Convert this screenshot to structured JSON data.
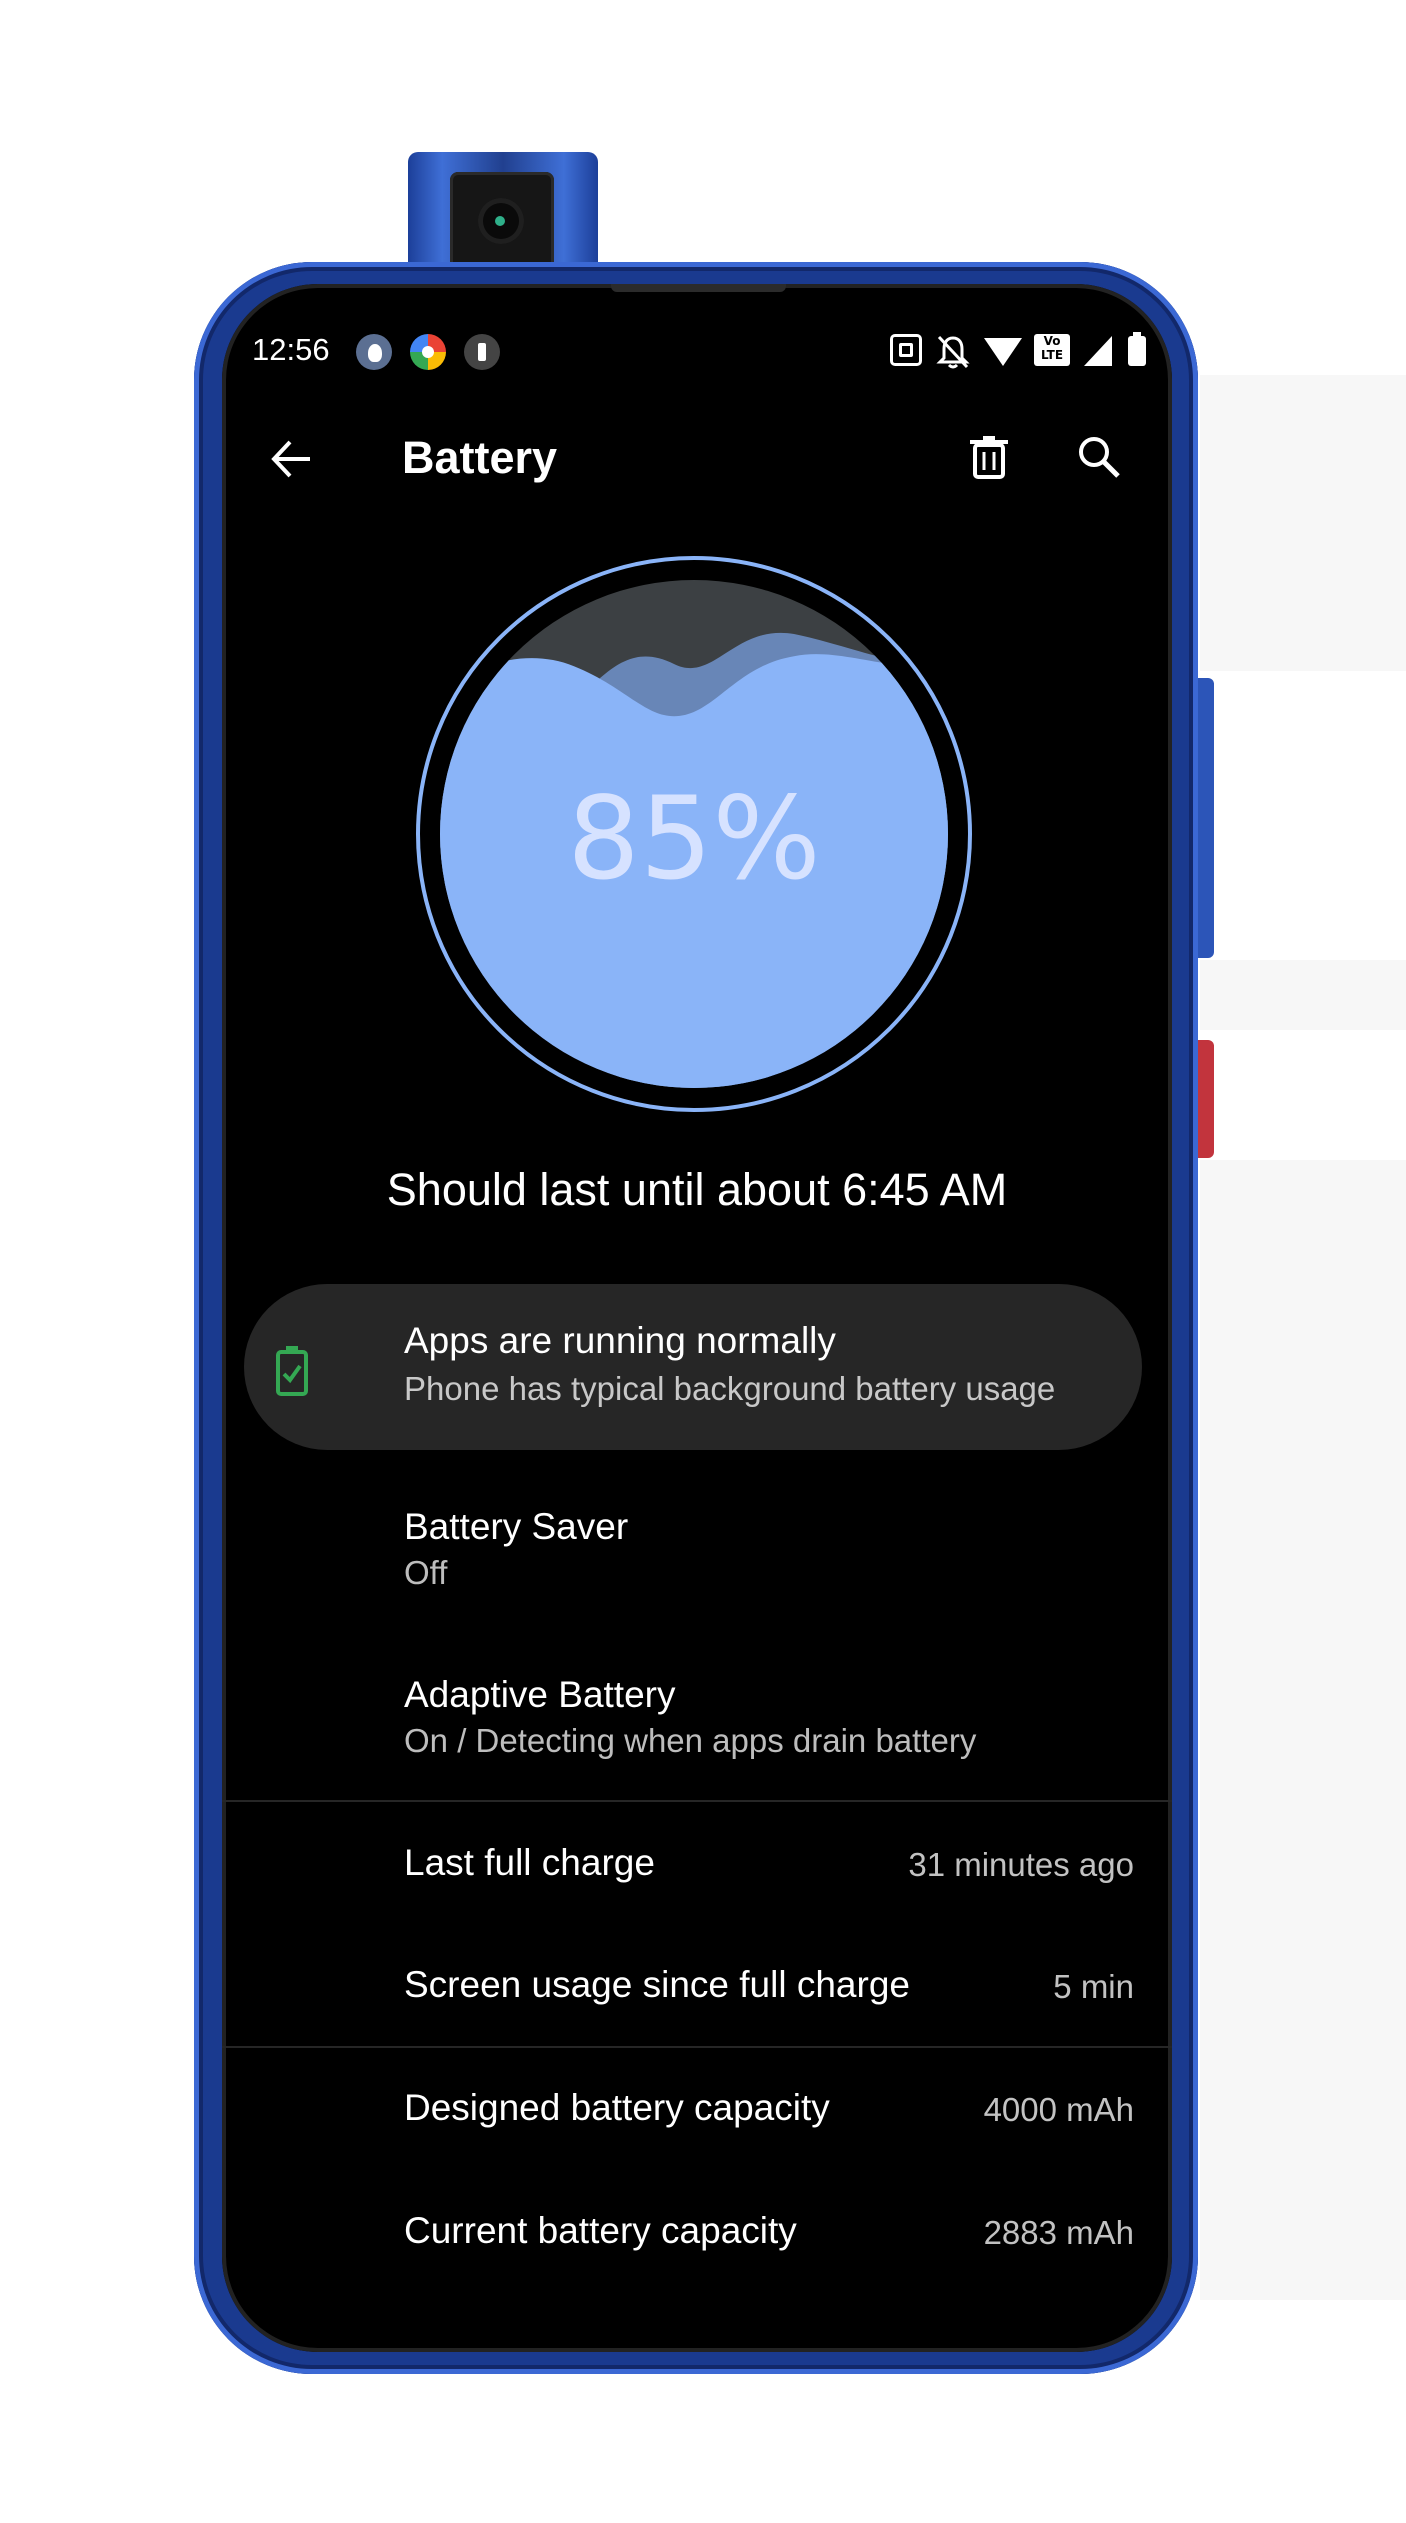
{
  "status_bar": {
    "time": "12:56",
    "notification_icons": [
      "avatar-icon",
      "photos-pinwheel-icon",
      "app-icon"
    ],
    "system_icons": [
      "nfc-icon",
      "bell-off-icon",
      "wifi-icon",
      "volte-icon",
      "cell-signal-icon",
      "battery-icon"
    ],
    "volte_text": "Vo LTE"
  },
  "toolbar": {
    "title": "Battery",
    "back_icon": "arrow-left-icon",
    "actions": [
      "trash-icon",
      "search-icon"
    ]
  },
  "battery": {
    "percent_label": "85%",
    "level": 0.85,
    "fill_color": "#8ab4f8",
    "ring_color": "#8ab4f8",
    "estimate": "Should last until about 6:45 AM"
  },
  "status_card": {
    "title": "Apps are running normally",
    "subtitle": "Phone has typical background battery usage",
    "icon": "battery-check-icon",
    "icon_color": "#34a853"
  },
  "settings": {
    "battery_saver": {
      "title": "Battery Saver",
      "subtitle": "Off"
    },
    "adaptive_battery": {
      "title": "Adaptive Battery",
      "subtitle": "On / Detecting when apps drain battery"
    }
  },
  "stats": [
    {
      "label": "Last full charge",
      "value": "31 minutes ago"
    },
    {
      "label": "Screen usage since full charge",
      "value": "5 min"
    },
    {
      "label": "Designed battery capacity",
      "value": "4000 mAh"
    },
    {
      "label": "Current battery capacity",
      "value": "2883 mAh"
    }
  ]
}
